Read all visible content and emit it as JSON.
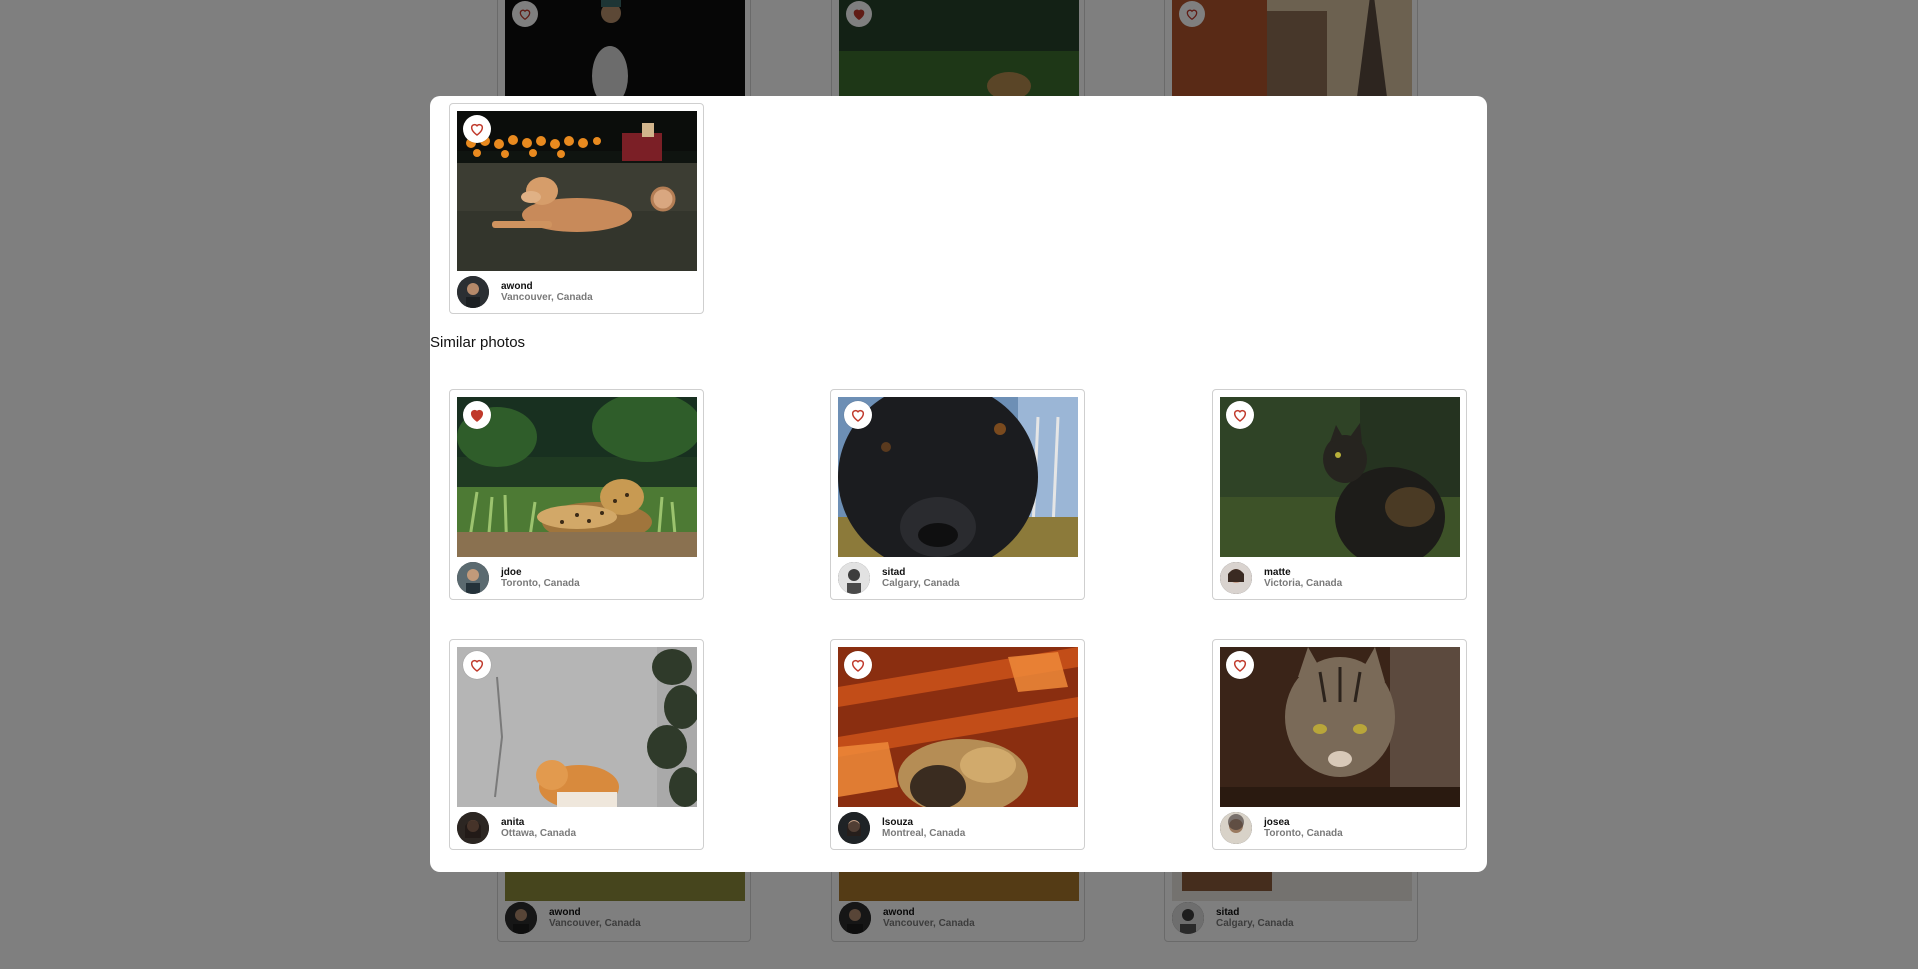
{
  "background_feed": {
    "cards": [
      {
        "liked": false
      },
      {
        "liked": true
      },
      {
        "liked": false
      },
      {
        "user": "awond",
        "location": "Vancouver, Canada"
      },
      {
        "user": "awond",
        "location": "Vancouver, Canada"
      },
      {
        "user": "sitad",
        "location": "Calgary, Canada"
      }
    ]
  },
  "modal": {
    "main_photo": {
      "user": "awond",
      "location": "Vancouver, Canada",
      "liked": false
    },
    "similar_title": "Similar photos",
    "similar": [
      {
        "user": "jdoe",
        "location": "Toronto, Canada",
        "liked": true
      },
      {
        "user": "sitad",
        "location": "Calgary, Canada",
        "liked": false
      },
      {
        "user": "matte",
        "location": "Victoria, Canada",
        "liked": false
      },
      {
        "user": "anita",
        "location": "Ottawa, Canada",
        "liked": false
      },
      {
        "user": "lsouza",
        "location": "Montreal, Canada",
        "liked": false
      },
      {
        "user": "josea",
        "location": "Toronto, Canada",
        "liked": false
      }
    ]
  },
  "colors": {
    "heart": "#c0392b",
    "scrim": "rgba(0,0,0,0.5)"
  }
}
